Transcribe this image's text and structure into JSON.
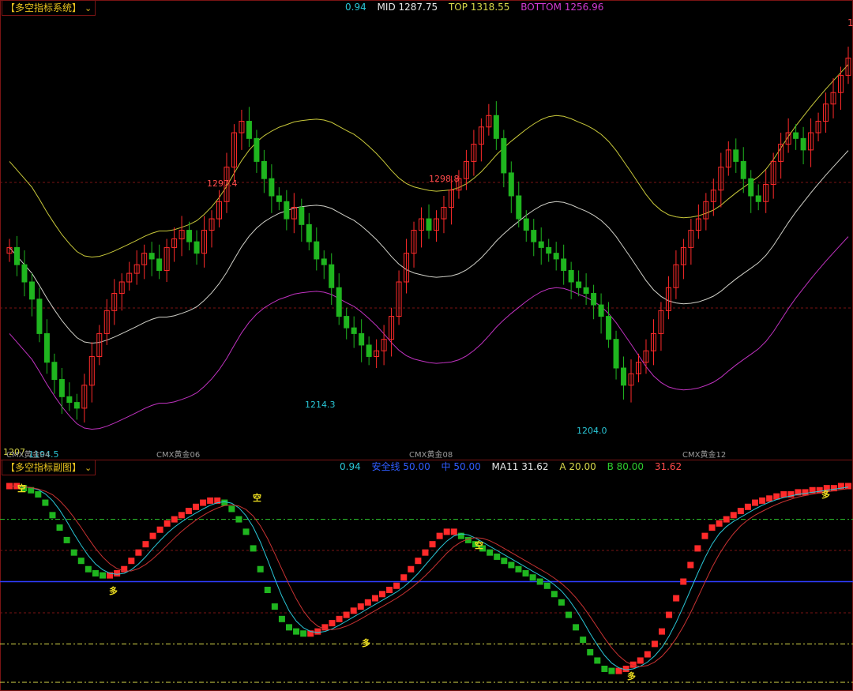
{
  "main_panel": {
    "title": "【多空指标系统】",
    "header": [
      {
        "text": "0.94",
        "color": "#29c6d6"
      },
      {
        "text": "MID 1287.75",
        "color": "#e6e6e6"
      },
      {
        "text": "TOP 1318.55",
        "color": "#d9d94a"
      },
      {
        "text": "BOTTOM 1256.96",
        "color": "#d23ad2"
      }
    ],
    "edge_label": "1",
    "price_labels": [
      {
        "text": "1297.4",
        "color": "#ff4b4b"
      },
      {
        "text": "1298.8",
        "color": "#ff4b4b"
      },
      {
        "text": "1214.3",
        "color": "#29c6d6"
      },
      {
        "text": "1204.0",
        "color": "#29c6d6"
      },
      {
        "text": "1194.5",
        "color": "#29c6d6"
      },
      {
        "text": "1207",
        "color": "#d9d94a"
      }
    ],
    "contract_labels": [
      "CMX黄金04",
      "CMX黄金06",
      "CMX黄金08",
      "CMX黄金12"
    ]
  },
  "sub_panel": {
    "title": "【多空指标副图】",
    "header": [
      {
        "text": "0.94",
        "color": "#29c6d6"
      },
      {
        "text": "安全线 50.00",
        "color": "#2f5cff"
      },
      {
        "text": "中 50.00",
        "color": "#2f5cff"
      },
      {
        "text": "MA11 31.62",
        "color": "#e6e6e6"
      },
      {
        "text": "A 20.00",
        "color": "#d9d94a"
      },
      {
        "text": "B 80.00",
        "color": "#2ecc2e"
      },
      {
        "text": "31.62",
        "color": "#ff4b4b"
      }
    ],
    "signal_labels": [
      "空",
      "多",
      "空",
      "多",
      "空",
      "多",
      "多"
    ]
  },
  "colors": {
    "up": "#ff2a2a",
    "down": "#1fb51f",
    "mid_line": "#d0d0c8",
    "top_line": "#c8c83a",
    "bottom_line": "#c032c0",
    "grid": "#7a1414",
    "safe_line": "#2f3dff"
  },
  "chart_data": [
    {
      "type": "candlestick",
      "title": "【多空指标系统】",
      "series": [
        {
          "name": "MID",
          "last": 1287.75
        },
        {
          "name": "TOP",
          "last": 1318.55
        },
        {
          "name": "BOTTOM",
          "last": 1256.96
        }
      ],
      "annotations": [
        1297.4,
        1298.8,
        1214.3,
        1204.0,
        1194.5
      ],
      "close": [
        1252,
        1246,
        1240,
        1234,
        1222,
        1212,
        1206,
        1200,
        1198,
        1196,
        1204,
        1214,
        1222,
        1230,
        1236,
        1240,
        1243,
        1246,
        1250,
        1248,
        1244,
        1252,
        1255,
        1258,
        1254,
        1250,
        1258,
        1262,
        1268,
        1280,
        1292,
        1296,
        1290,
        1282,
        1276,
        1270,
        1268,
        1262,
        1266,
        1260,
        1254,
        1248,
        1246,
        1238,
        1228,
        1224,
        1222,
        1218,
        1214,
        1216,
        1220,
        1228,
        1240,
        1250,
        1258,
        1262,
        1258,
        1262,
        1266,
        1272,
        1276,
        1282,
        1288,
        1294,
        1298,
        1290,
        1278,
        1270,
        1262,
        1258,
        1254,
        1252,
        1250,
        1248,
        1244,
        1240,
        1238,
        1236,
        1232,
        1228,
        1220,
        1210,
        1204,
        1208,
        1212,
        1216,
        1222,
        1230,
        1238,
        1246,
        1252,
        1258,
        1262,
        1268,
        1272,
        1280,
        1286,
        1282,
        1276,
        1270,
        1268,
        1274,
        1282,
        1288,
        1292,
        1290,
        1286,
        1292,
        1296,
        1302,
        1306,
        1312,
        1318
      ],
      "xlabels": [
        "CMX黄金04",
        "CMX黄金06",
        "CMX黄金08",
        "CMX黄金12"
      ]
    },
    {
      "type": "line",
      "title": "【多空指标副图】",
      "series": [
        {
          "name": "MA11",
          "last": 31.62
        },
        {
          "name": "安全线",
          "last": 50.0
        }
      ],
      "levels": {
        "A": 20.0,
        "B": 80.0,
        "中": 50.0
      },
      "ylim": [
        0,
        100
      ],
      "values": [
        96,
        96,
        95,
        94,
        92,
        88,
        82,
        76,
        70,
        64,
        60,
        56,
        54,
        53,
        53,
        54,
        56,
        60,
        64,
        68,
        72,
        75,
        78,
        80,
        82,
        84,
        86,
        88,
        89,
        89,
        88,
        85,
        80,
        74,
        66,
        56,
        46,
        38,
        32,
        28,
        26,
        25,
        25,
        26,
        28,
        30,
        32,
        34,
        36,
        38,
        40,
        42,
        44,
        46,
        48,
        52,
        56,
        60,
        64,
        68,
        72,
        74,
        74,
        72,
        70,
        68,
        66,
        64,
        62,
        60,
        58,
        56,
        54,
        52,
        50,
        48,
        44,
        40,
        34,
        28,
        22,
        16,
        12,
        8,
        7,
        7,
        8,
        10,
        12,
        15,
        20,
        26,
        34,
        42,
        50,
        58,
        66,
        72,
        76,
        78,
        80,
        82,
        84,
        86,
        88,
        89,
        90,
        91,
        92,
        92,
        93,
        93,
        94,
        94,
        95,
        95,
        96,
        96
      ]
    }
  ]
}
